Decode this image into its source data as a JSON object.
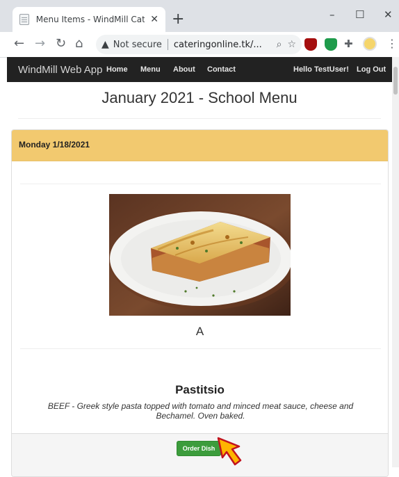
{
  "browser": {
    "tab": {
      "title": "Menu Items - WindMill Catering",
      "close": "✕"
    },
    "new_tab": "+",
    "window_controls": {
      "minimize": "–",
      "maximize": "☐",
      "close": "✕"
    },
    "address_bar": {
      "security_label": "Not secure",
      "url": "cateringonline.tk/..."
    },
    "icons": [
      "back-icon",
      "forward-icon",
      "reload-icon",
      "home-icon",
      "warning-icon",
      "zoom-icon",
      "bookmark-star-icon",
      "ublock-icon",
      "shield-extension-icon",
      "extensions-puzzle-icon",
      "profile-avatar-icon",
      "kebab-menu-icon"
    ]
  },
  "app": {
    "brand": "WindMill Web App",
    "nav": [
      "Home",
      "Menu",
      "About",
      "Contact"
    ],
    "greeting": "Hello TestUser!",
    "logout": "Log Out"
  },
  "page": {
    "title": "January 2021 - School Menu",
    "day": "Monday 1/18/2021",
    "dish_category": "A",
    "dish_name": "Pastitsio",
    "dish_description": "BEEF - Greek style pasta topped with tomato and minced meat sauce, cheese and Bechamel. Oven baked.",
    "order_button": "Order Dish"
  },
  "colors": {
    "navbar": "#222222",
    "day_heading": "#f2c96f",
    "order_button": "#3c9c3c",
    "cursor": "#ffb400"
  }
}
